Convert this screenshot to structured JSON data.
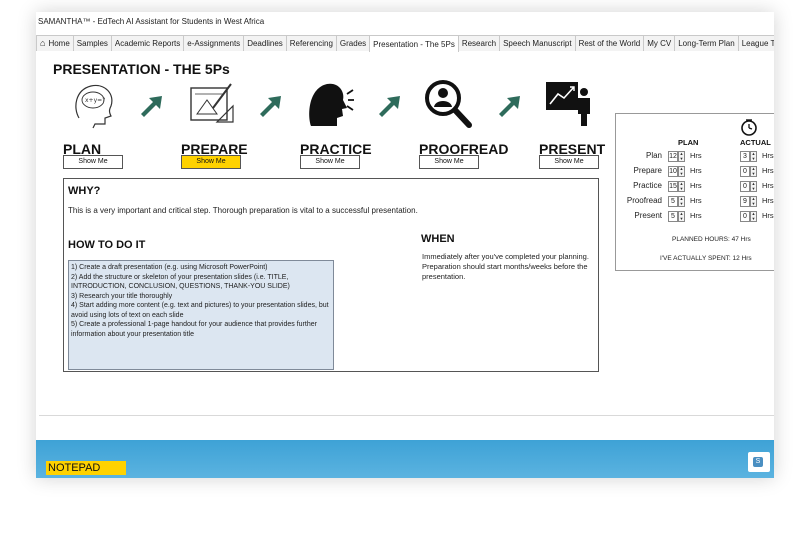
{
  "window": {
    "title": "SAMANTHA™ - EdTech AI Assistant for Students in West Africa"
  },
  "tabs": [
    {
      "label": "Home",
      "icon": "home-icon"
    },
    {
      "label": "Samples"
    },
    {
      "label": "Academic Reports"
    },
    {
      "label": "e-Assignments"
    },
    {
      "label": "Deadlines"
    },
    {
      "label": "Referencing"
    },
    {
      "label": "Grades"
    },
    {
      "label": "Presentation - The 5Ps",
      "active": true
    },
    {
      "label": "Research"
    },
    {
      "label": "Speech Manuscript"
    },
    {
      "label": "Rest of the World"
    },
    {
      "label": "My CV"
    },
    {
      "label": "Long-Term Plan"
    },
    {
      "label": "League Table"
    }
  ],
  "page": {
    "title": "PRESENTATION - THE 5Ps",
    "steps": [
      {
        "label": "PLAN",
        "button": "Show Me",
        "icon": "thinking-head-icon"
      },
      {
        "label": "PREPARE",
        "button": "Show Me",
        "icon": "drafting-icon",
        "active": true
      },
      {
        "label": "PRACTICE",
        "button": "Show Me",
        "icon": "speaking-head-icon"
      },
      {
        "label": "PROOFREAD",
        "button": "Show Me",
        "icon": "magnify-person-icon"
      },
      {
        "label": "PRESENT",
        "button": "Show Me",
        "icon": "presenter-board-icon"
      }
    ],
    "arrow_icon": "arrow-right-icon",
    "accent_color": "#2e6b5b",
    "active_button_color": "#ffd200"
  },
  "content": {
    "why_heading": "WHY?",
    "why_text": "This is a very important and critical step. Thorough preparation is vital to a successful presentation.",
    "how_heading": "HOW TO DO IT",
    "how_steps": [
      "1) Create a draft presentation (e.g. using Microsoft PowerPoint)",
      "2) Add the structure or skeleton of your presentation slides (i.e. TITLE, INTRODUCTION, CONCLUSION, QUESTIONS, THANK-YOU SLIDE)",
      "3) Research your title thoroughly",
      "4) Start adding more content (e.g. text and pictures) to your presentation slides, but avoid using lots of text on each slide",
      "5) Create a professional 1-page handout for your audience that provides further information about your presentation title"
    ],
    "when_heading": "WHEN",
    "when_text": "Immediately after you've completed your planning. Preparation should start months/weeks before the presentation."
  },
  "hours_panel": {
    "icon": "clock-icon",
    "plan_header": "PLAN",
    "actual_header": "ACTUAL",
    "unit": "Hrs",
    "rows": [
      {
        "label": "Plan",
        "plan": "12",
        "actual": "3"
      },
      {
        "label": "Prepare",
        "plan": "10",
        "actual": "0"
      },
      {
        "label": "Practice",
        "plan": "15",
        "actual": "0"
      },
      {
        "label": "Proofread",
        "plan": "5",
        "actual": "9"
      },
      {
        "label": "Present",
        "plan": "5",
        "actual": "0"
      }
    ],
    "planned_text": "PLANNED HOURS: 47 Hrs",
    "spent_text": "I'VE ACTUALLY SPENT: 12 Hrs"
  },
  "notepad": {
    "label": "NOTEPAD",
    "color": "#ffd200"
  },
  "side_button": {
    "label": "S",
    "icon": "sidebar-toggle-icon"
  }
}
